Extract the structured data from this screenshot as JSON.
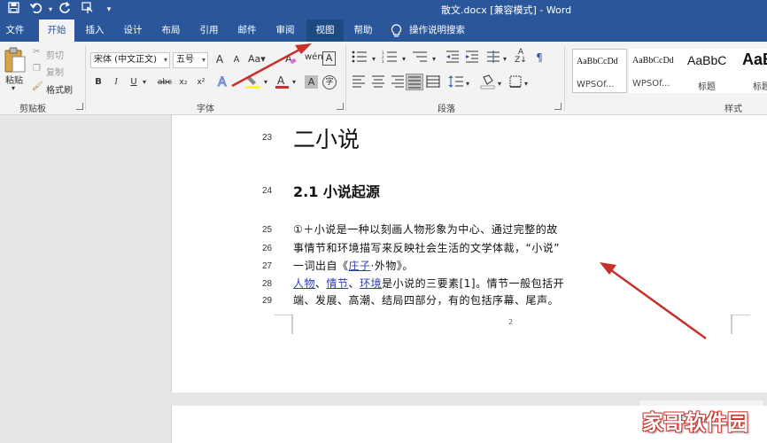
{
  "window": {
    "title": "散文.docx [兼容模式] - Word",
    "qat_icons": [
      "save-icon",
      "undo-icon",
      "redo-icon",
      "touch-mode-icon",
      "customize-qat-icon"
    ]
  },
  "tabs": [
    {
      "label": "文件"
    },
    {
      "label": "开始",
      "active": true
    },
    {
      "label": "插入"
    },
    {
      "label": "设计"
    },
    {
      "label": "布局"
    },
    {
      "label": "引用"
    },
    {
      "label": "邮件"
    },
    {
      "label": "审阅"
    },
    {
      "label": "视图",
      "highlighted": true
    },
    {
      "label": "帮助"
    },
    {
      "label": "操作说明搜索"
    }
  ],
  "clipboard": {
    "paste": "粘贴",
    "cut": "剪切",
    "copy": "复制",
    "format_painter": "格式刷",
    "group_label": "剪贴板"
  },
  "font": {
    "font_name": "宋体 (中文正文)",
    "font_size": "五号",
    "grow": "A",
    "shrink": "A",
    "bold": "B",
    "italic": "I",
    "underline": "U",
    "strike": "abc",
    "subscript": "x₂",
    "superscript": "x²",
    "group_label": "字体"
  },
  "paragraph": {
    "group_label": "段落"
  },
  "styles": {
    "items": [
      {
        "sample": "AaBbCcDd",
        "name": "WPSOf..."
      },
      {
        "sample": "AaBbCcDd",
        "name": "WPSOf..."
      },
      {
        "sample": "AaBbC",
        "name": "标题"
      },
      {
        "sample": "AaB",
        "name": "标题"
      }
    ],
    "group_label": "样式"
  },
  "document": {
    "lines": [
      {
        "num": "23",
        "text": "二小说"
      },
      {
        "num": "24",
        "text": "2.1 小说起源"
      },
      {
        "num": "25",
        "text": "①＋小说是一种以刻画人物形象为中心、通过完整的故"
      },
      {
        "num": "26",
        "text": "事情节和环境描写来反映社会生活的文学体裁，“小说”"
      },
      {
        "num": "27",
        "pre": "一词出自《",
        "link": "庄子",
        "post": "·外物》。"
      },
      {
        "num": "28",
        "link1": "人物",
        "sep1": "、",
        "link2": "情节",
        "sep2": "、",
        "link3": "环境",
        "post": "是小说的三要素[1]。情节一般包括开"
      },
      {
        "num": "29",
        "text": "端、发展、高潮、结局四部分，有的包括序幕、尾声。"
      }
    ],
    "page_number": "2"
  },
  "watermark": {
    "text": "家哥软件园"
  },
  "colors": {
    "brand": "#2b579a",
    "arrow": "#c8312b"
  }
}
